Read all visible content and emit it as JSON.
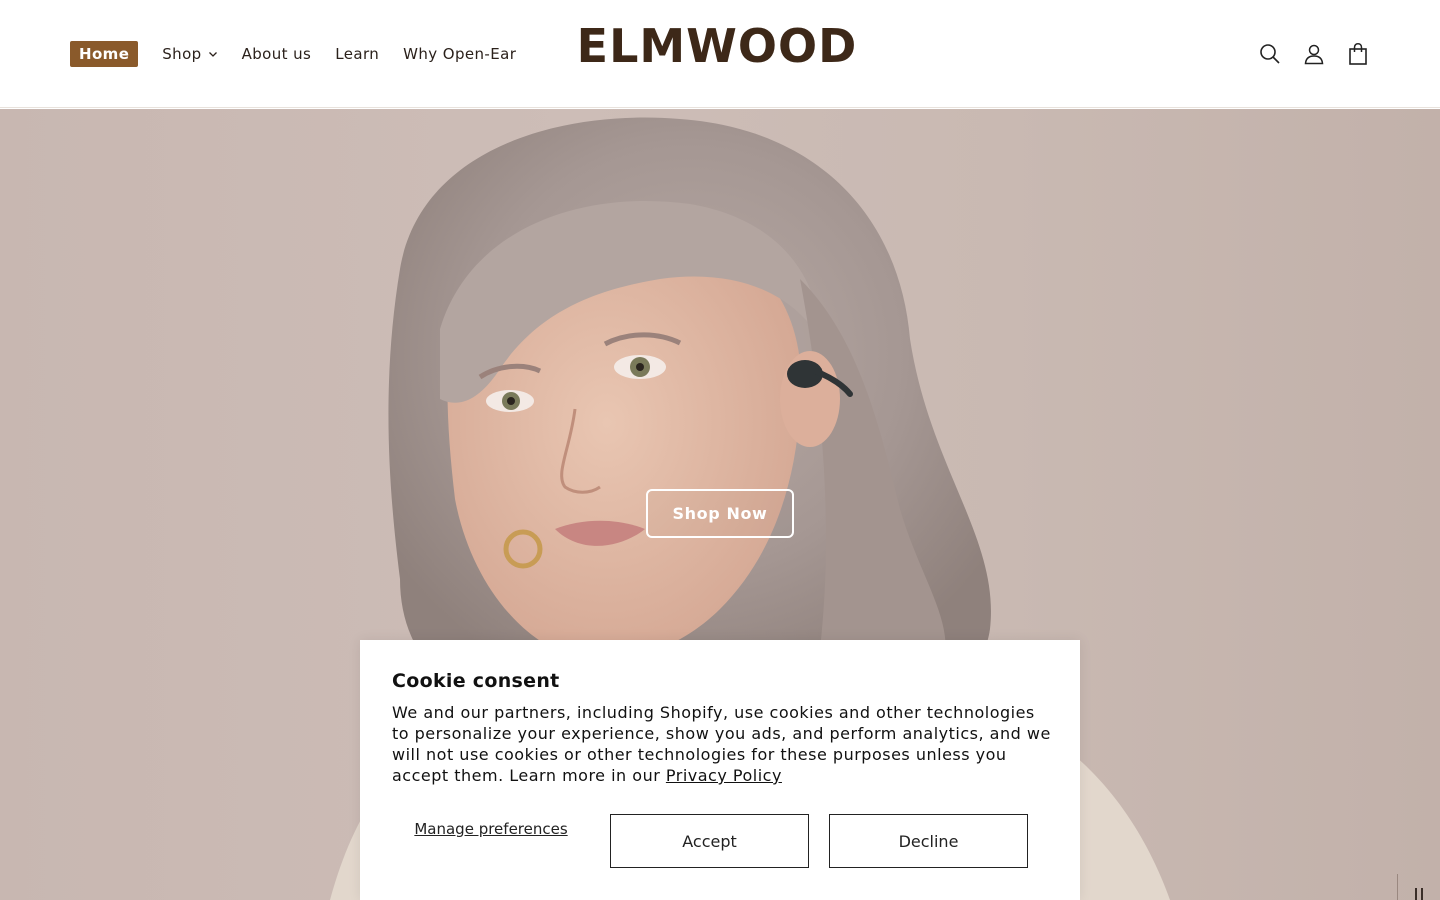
{
  "header": {
    "nav": [
      {
        "label": "Home",
        "active": true
      },
      {
        "label": "Shop",
        "has_dropdown": true
      },
      {
        "label": "About us"
      },
      {
        "label": "Learn"
      },
      {
        "label": "Why Open-Ear"
      }
    ],
    "logo_text": "ELMWOOD",
    "icons": [
      "search-icon",
      "account-icon",
      "cart-icon"
    ]
  },
  "hero": {
    "cta_label": "Shop Now",
    "slideshow_control": "pause-icon"
  },
  "cookie_banner": {
    "title": "Cookie consent",
    "body": "We and our partners, including Shopify, use cookies and other technologies to personalize your experience, show you ads, and perform analytics, and we will not use cookies or other technologies for these purposes unless you accept them. Learn more in our",
    "privacy_link": "Privacy Policy",
    "manage_label": "Manage preferences",
    "accept_label": "Accept",
    "decline_label": "Decline"
  },
  "colors": {
    "accent": "#8a5a2b",
    "logo": "#3d2818",
    "hero_bg": "#c8b7b1"
  }
}
